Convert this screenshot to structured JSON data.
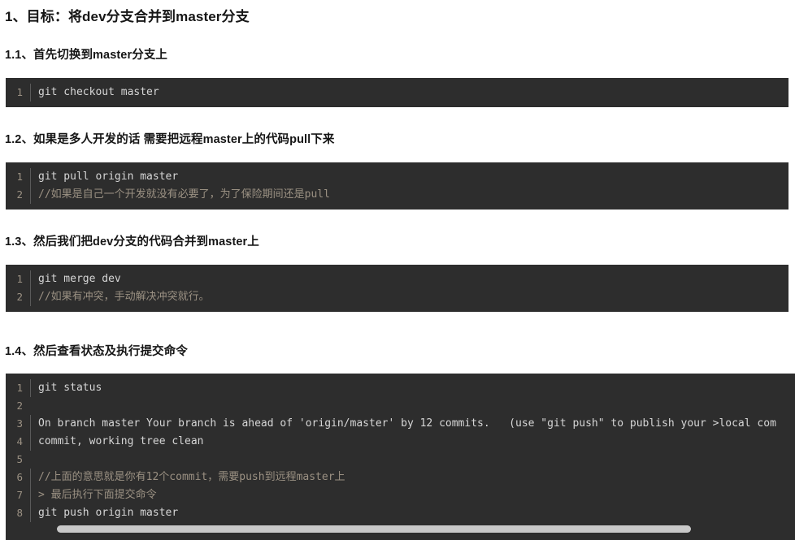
{
  "document": {
    "title": "1、目标：将dev分支合并到master分支",
    "sections": [
      {
        "heading": "1.1、首先切换到master分支上",
        "code_lines": [
          {
            "n": "1",
            "text": "git checkout master"
          }
        ]
      },
      {
        "heading": "1.2、如果是多人开发的话 需要把远程master上的代码pull下来",
        "code_lines": [
          {
            "n": "1",
            "text": "git pull origin master"
          },
          {
            "n": "2",
            "text": "//如果是自己一个开发就没有必要了，为了保险期间还是pull"
          }
        ]
      },
      {
        "heading": "1.3、然后我们把dev分支的代码合并到master上",
        "code_lines": [
          {
            "n": "1",
            "text": "git merge dev"
          },
          {
            "n": "2",
            "text": "//如果有冲突，手动解决冲突就行。"
          }
        ]
      },
      {
        "heading": "1.4、然后查看状态及执行提交命令",
        "code_lines": [
          {
            "n": "1",
            "text": "git status"
          },
          {
            "n": "2",
            "text": ""
          },
          {
            "n": "3",
            "text": "On branch master Your branch is ahead of 'origin/master' by 12 commits.   (use \"git push\" to publish your >local com"
          },
          {
            "n": "4",
            "text": "commit, working tree clean"
          },
          {
            "n": "5",
            "text": ""
          },
          {
            "n": "6",
            "text": "//上面的意思就是你有12个commit，需要push到远程master上"
          },
          {
            "n": "7",
            "text": "> 最后执行下面提交命令"
          },
          {
            "n": "8",
            "text": "git push origin master"
          }
        ],
        "scrollbar": {
          "visible": true
        }
      }
    ]
  },
  "colors": {
    "page_background": "#ffffff",
    "code_background": "#2d2d2d",
    "code_text": "#d6d6d6",
    "line_number": "#9b9183",
    "comment": "#9b9183",
    "heading": "#161616",
    "scrollbar_thumb": "#c8c8c8"
  }
}
